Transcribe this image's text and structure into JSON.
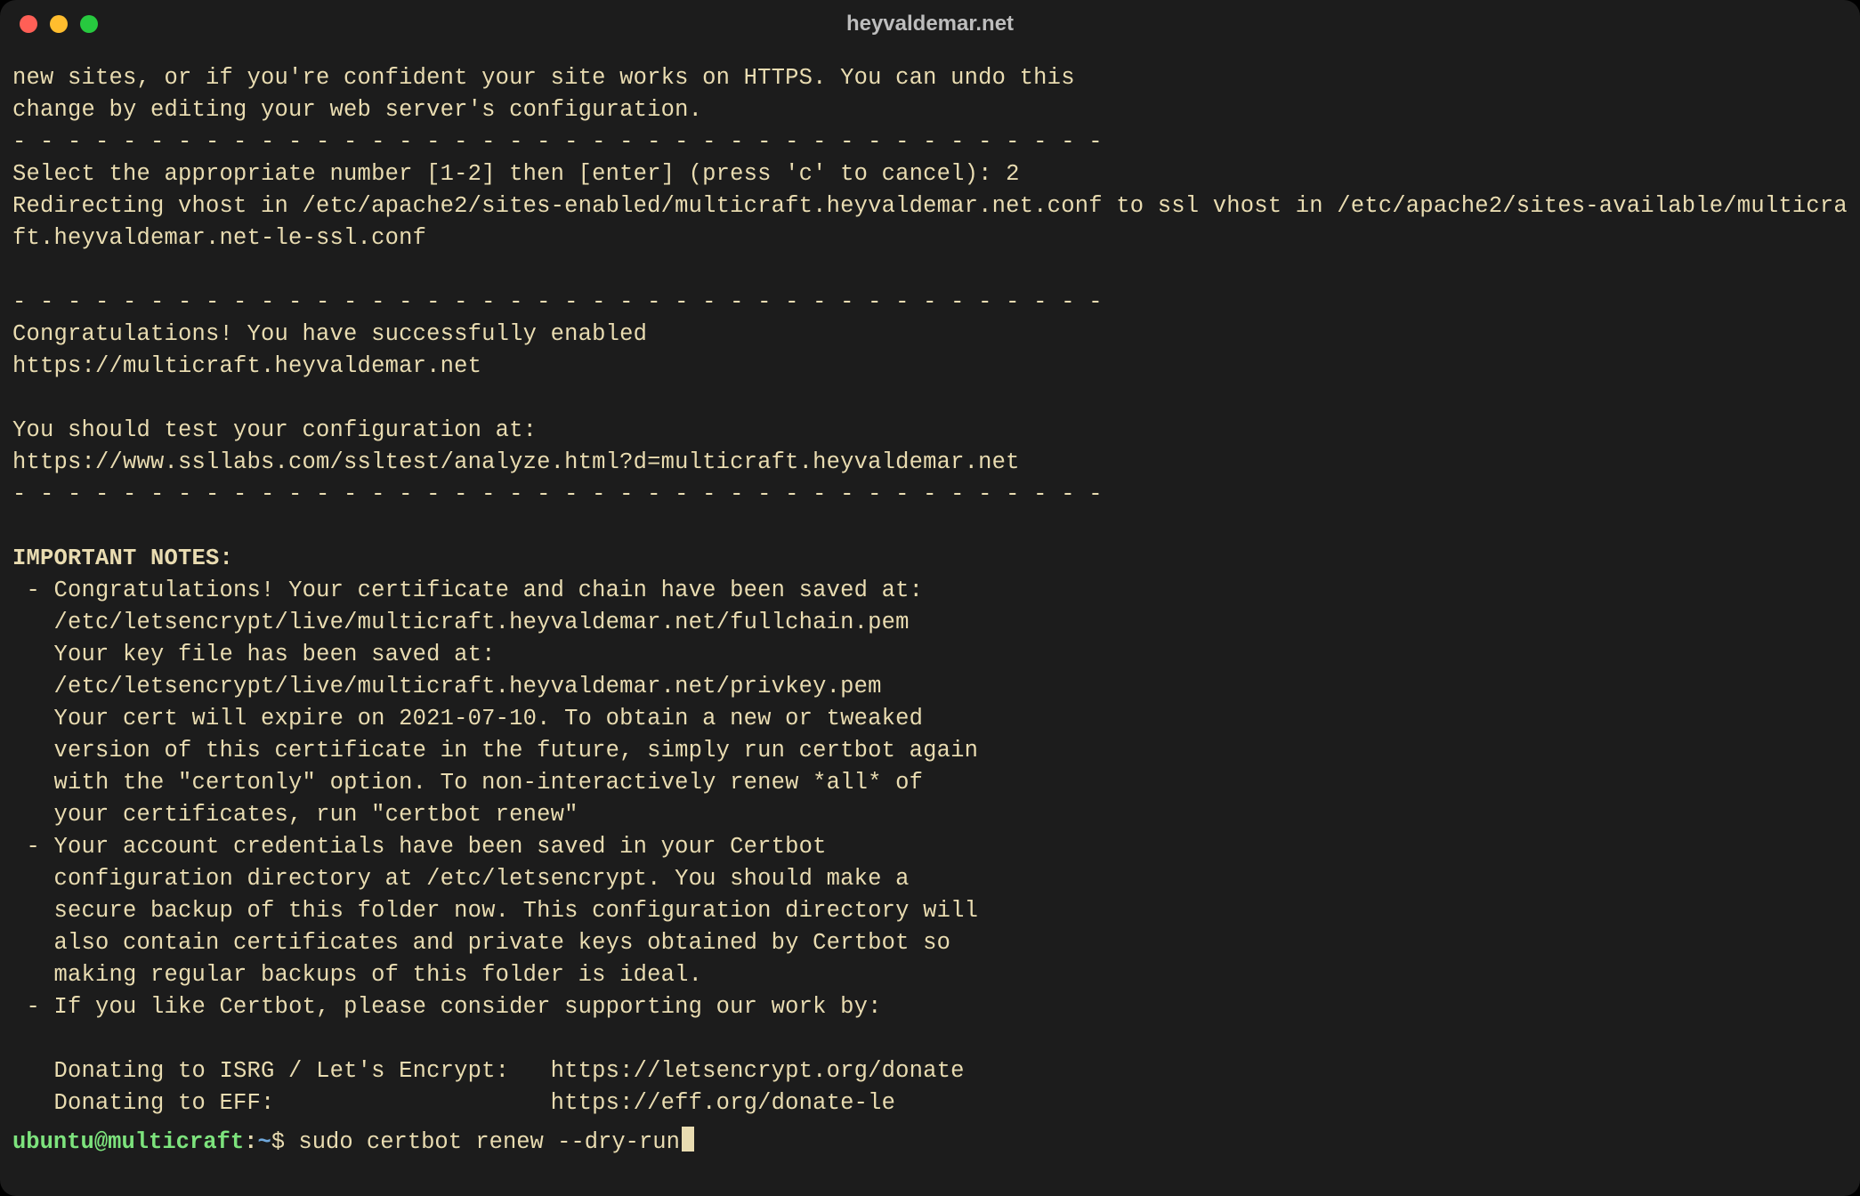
{
  "window": {
    "title": "heyvaldemar.net"
  },
  "colors": {
    "bg": "#1c1c1c",
    "text": "#e9dcb1",
    "prompt_green": "#7de37d",
    "prompt_blue": "#6fa8dc",
    "tl_close": "#ff5f56",
    "tl_min": "#ffbd2e",
    "tl_max": "#27c93f"
  },
  "terminal": {
    "lines": [
      "new sites, or if you're confident your site works on HTTPS. You can undo this",
      "change by editing your web server's configuration.",
      "- - - - - - - - - - - - - - - - - - - - - - - - - - - - - - - - - - - - - - - -",
      "Select the appropriate number [1-2] then [enter] (press 'c' to cancel): 2",
      "Redirecting vhost in /etc/apache2/sites-enabled/multicraft.heyvaldemar.net.conf to ssl vhost in /etc/apache2/sites-available/multicraft.heyvaldemar.net-le-ssl.conf",
      "",
      "- - - - - - - - - - - - - - - - - - - - - - - - - - - - - - - - - - - - - - - -",
      "Congratulations! You have successfully enabled",
      "https://multicraft.heyvaldemar.net",
      "",
      "You should test your configuration at:",
      "https://www.ssllabs.com/ssltest/analyze.html?d=multicraft.heyvaldemar.net",
      "- - - - - - - - - - - - - - - - - - - - - - - - - - - - - - - - - - - - - - - -",
      ""
    ],
    "important_header": "IMPORTANT NOTES:",
    "important_lines": [
      " - Congratulations! Your certificate and chain have been saved at:",
      "   /etc/letsencrypt/live/multicraft.heyvaldemar.net/fullchain.pem",
      "   Your key file has been saved at:",
      "   /etc/letsencrypt/live/multicraft.heyvaldemar.net/privkey.pem",
      "   Your cert will expire on 2021-07-10. To obtain a new or tweaked",
      "   version of this certificate in the future, simply run certbot again",
      "   with the \"certonly\" option. To non-interactively renew *all* of",
      "   your certificates, run \"certbot renew\"",
      " - Your account credentials have been saved in your Certbot",
      "   configuration directory at /etc/letsencrypt. You should make a",
      "   secure backup of this folder now. This configuration directory will",
      "   also contain certificates and private keys obtained by Certbot so",
      "   making regular backups of this folder is ideal.",
      " - If you like Certbot, please consider supporting our work by:",
      "",
      "   Donating to ISRG / Let's Encrypt:   https://letsencrypt.org/donate",
      "   Donating to EFF:                    https://eff.org/donate-le",
      ""
    ]
  },
  "prompt": {
    "user": "ubuntu",
    "at": "@",
    "host": "multicraft",
    "colon": ":",
    "path": "~",
    "symbol": "$ ",
    "command": "sudo certbot renew --dry-run"
  }
}
